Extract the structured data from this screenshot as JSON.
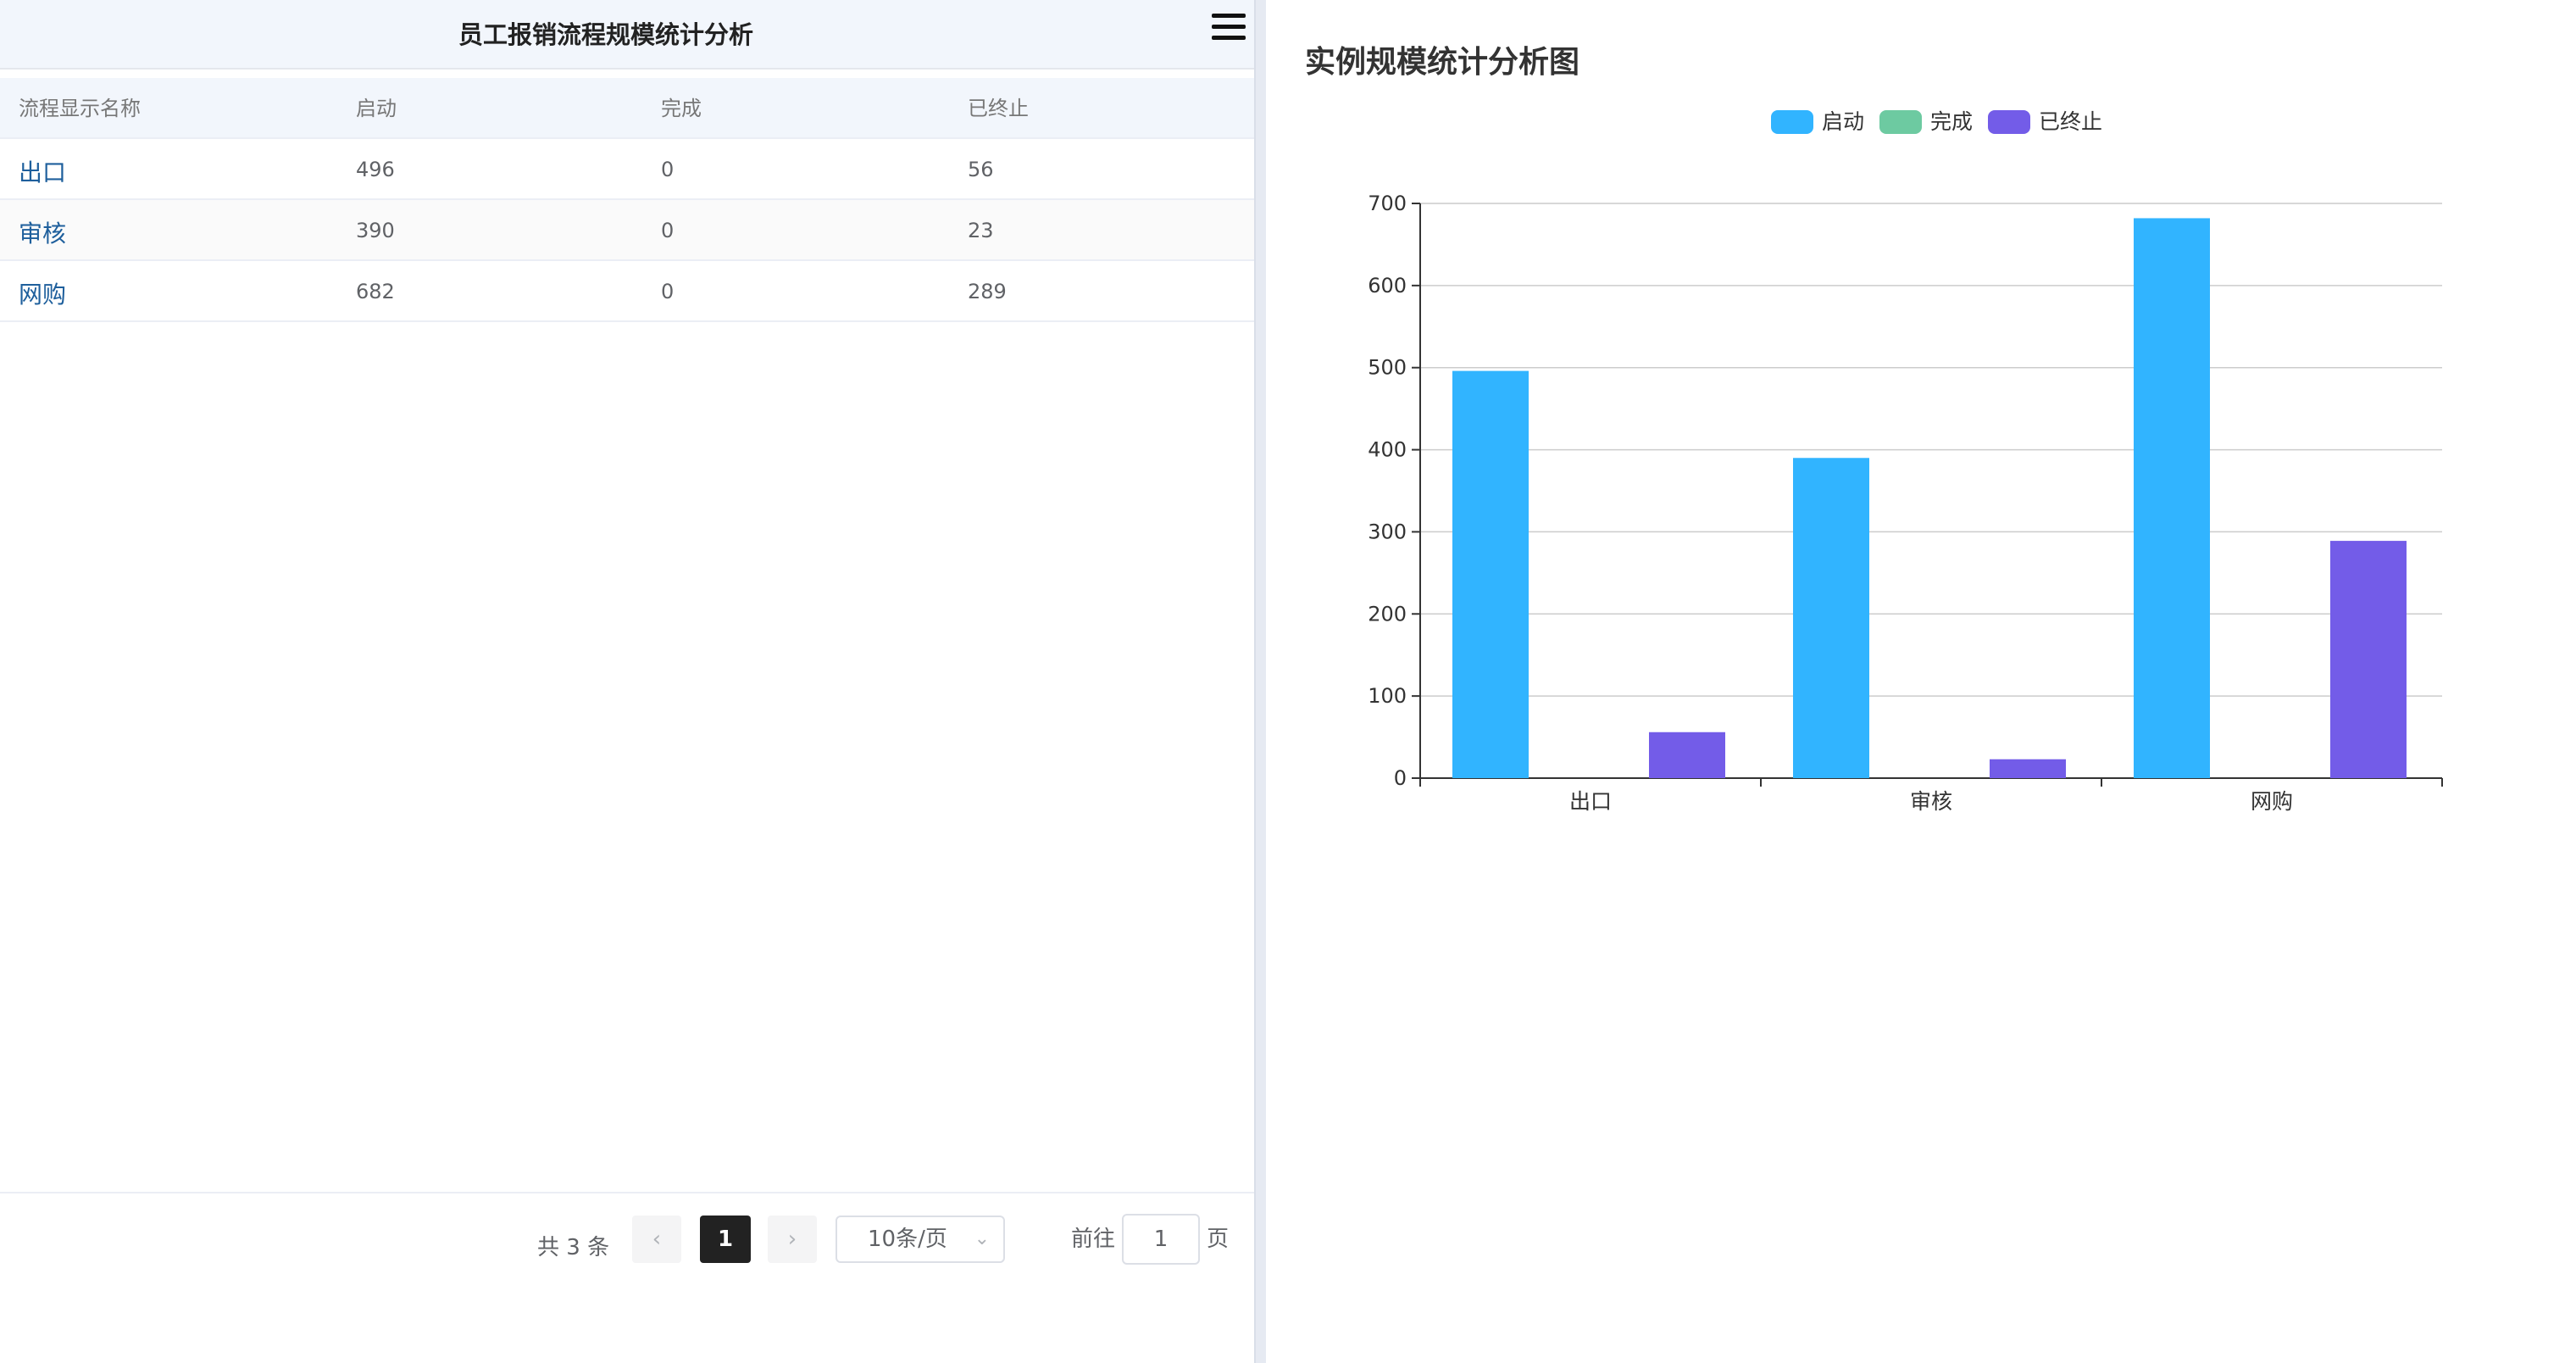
{
  "left_panel": {
    "title": "员工报销流程规模统计分析",
    "columns": [
      "流程显示名称",
      "启动",
      "完成",
      "已终止"
    ],
    "rows": [
      {
        "name": "出口",
        "started": "496",
        "completed": "0",
        "terminated": "56"
      },
      {
        "name": "审核",
        "started": "390",
        "completed": "0",
        "terminated": "23"
      },
      {
        "name": "网购",
        "started": "682",
        "completed": "0",
        "terminated": "289"
      }
    ],
    "pagination": {
      "total_text": "共 3 条",
      "prev_icon": "‹",
      "current_page": "1",
      "next_icon": "›",
      "page_size": "10条/页",
      "goto_label": "前往",
      "goto_value": "1",
      "page_label": "页"
    }
  },
  "right_panel": {
    "chart_title": "实例规模统计分析图"
  },
  "chart_data": {
    "type": "bar",
    "categories": [
      "出口",
      "审核",
      "网购"
    ],
    "series": [
      {
        "name": "启动",
        "values": [
          496,
          390,
          682
        ],
        "color": "#31b4ff"
      },
      {
        "name": "完成",
        "values": [
          0,
          0,
          0
        ],
        "color": "#6dcaa1"
      },
      {
        "name": "已终止",
        "values": [
          56,
          23,
          289
        ],
        "color": "#735ce8"
      }
    ],
    "ylim": [
      0,
      700
    ],
    "yticks": [
      0,
      100,
      200,
      300,
      400,
      500,
      600,
      700
    ],
    "grid": true,
    "legend": "top-center"
  }
}
